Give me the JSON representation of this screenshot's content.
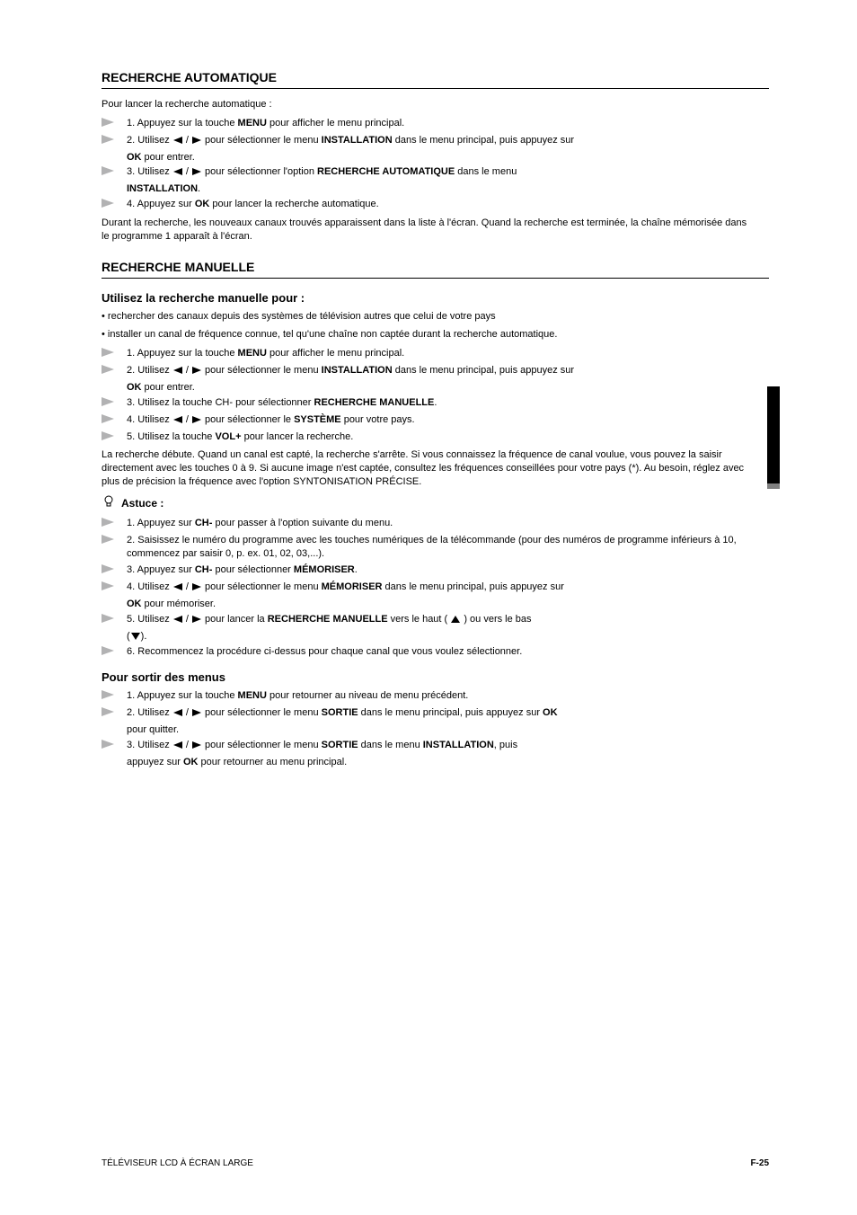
{
  "footer": {
    "left": "TÉLÉVISEUR LCD À ÉCRAN LARGE",
    "right": "F-25"
  },
  "sideTabColor": "#000000",
  "section1": {
    "title": "RECHERCHE AUTOMATIQUE",
    "intro": "",
    "steps": [
      {
        "num": "1.",
        "text_before": "Appuyez sur la touche ",
        "bold": "MENU",
        "text_after": " pour afficher le menu principal."
      },
      {
        "num": "2.",
        "text_before": "Utilisez ",
        "icons": true,
        "text_mid": " pour sélectionner le menu ",
        "bold": "INSTALLATION",
        "text_after": " dans le menu principal, puis appuyez sur"
      },
      {
        "continue": true,
        "bold": "OK",
        "text_after": " pour entrer."
      },
      {
        "num": "3.",
        "text_before": "Utilisez ",
        "icons": true,
        "text_mid": " pour sélectionner l'option ",
        "bold": "RECHERCHE AUTOMATIQUE",
        "text_after": " dans le menu"
      },
      {
        "continue": true,
        "bold": "INSTALLATION",
        "text_after": "."
      },
      {
        "num": "4.",
        "text_before": "Appuyez sur ",
        "bold": "OK",
        "text_after": " pour lancer la recherche automatique."
      }
    ],
    "outro": "Durant la recherche, les nouveaux canaux trouvés apparaissent dans la liste à l'écran. Quand la recherche est terminée, la chaîne mémorisée dans le programme 1 apparaît à l'écran."
  },
  "section2": {
    "title": "RECHERCHE MANUELLE",
    "subA": {
      "title": "Utilisez la recherche manuelle pour :",
      "lines": [
        "rechercher des canaux depuis des systèmes de télévision autres que celui de votre pays",
        "installer un canal de fréquence connue, tel qu'une chaîne non captée durant la recherche automatique."
      ]
    },
    "steps1": [
      {
        "num": "1.",
        "text_before": "Appuyez sur la touche ",
        "bold": "MENU",
        "text_after": " pour afficher le menu principal."
      },
      {
        "num": "2.",
        "text_before": "Utilisez ",
        "icons": true,
        "text_mid": " pour sélectionner le menu ",
        "bold": "INSTALLATION",
        "text_after": " dans le menu principal, puis appuyez sur"
      },
      {
        "continue": true,
        "bold": "OK",
        "text_after": " pour entrer."
      },
      {
        "num": "3.",
        "text_before": "Utilisez la touche CH- pour sélectionner ",
        "bold": "RECHERCHE MANUELLE",
        "text_after": "."
      },
      {
        "num": "4.",
        "text_before": "Utilisez ",
        "icons": true,
        "text_mid": " pour sélectionner le ",
        "bold": "SYSTÈME",
        "text_after": " pour votre pays."
      },
      {
        "num": "5.",
        "text_before": "Utilisez la touche ",
        "bold": "VOL+",
        "text_after": " pour lancer la recherche."
      }
    ],
    "standalone": "La recherche débute. Quand un canal est capté, la recherche s'arrête. Si vous connaissez la fréquence de canal voulue, vous pouvez la saisir directement avec les touches 0 à 9. Si aucune image n'est captée, consultez les fréquences conseillées pour votre pays (*). Au besoin, réglez avec plus de précision la fréquence avec l'option SYNTONISATION PRÉCISE.",
    "tip": "Astuce :",
    "steps2": [
      {
        "num": "1.",
        "text_before": "Appuyez sur ",
        "bold": "CH-",
        "text_after": " pour passer à l'option suivante du menu."
      },
      {
        "num": "2.",
        "text_before": "Saisissez le numéro du programme avec les touches numériques de la télécommande (pour des numéros de programme inférieurs à 10, commencez par saisir 0, p. ex. 01, 02, 03,...)."
      },
      {
        "num": "3.",
        "text_before": "Appuyez sur ",
        "bold": "CH-",
        "text_after": " pour sélectionner ",
        "bold2": "MÉMORISER",
        "text_after2": "."
      },
      {
        "num": "4.",
        "text_before": "Utilisez ",
        "icons": true,
        "text_mid": " pour sélectionner le menu ",
        "bold": "MÉMORISER",
        "text_after": " dans le menu principal, puis appuyez sur"
      },
      {
        "continue": true,
        "bold": "OK",
        "text_after": " pour mémoriser."
      },
      {
        "num": "5.",
        "text_before": "Utilisez ",
        "icons": true,
        "text_mid": " pour lancer la ",
        "bold": "RECHERCHE MANUELLE",
        "text_after": " vers le haut ("
      },
      {
        "trail2_icons": true,
        "trail2_text": ") ou vers le bas"
      },
      {
        "continue_icons_paren": true,
        "text_after": ")."
      },
      {
        "num": "6.",
        "text_before": "Recommencez la procédure ci-dessus pour chaque canal que vous voulez sélectionner."
      }
    ],
    "subC": {
      "title": "Pour sortir des menus",
      "steps": [
        {
          "num": "1.",
          "text_before": "Appuyez sur la touche ",
          "bold": "MENU",
          "text_after": " pour retourner au niveau de menu précédent."
        },
        {
          "num": "2.",
          "text_before": "Utilisez ",
          "icons": true,
          "text_mid": " pour sélectionner le menu ",
          "bold": "SORTIE",
          "text_after": " dans le menu principal, puis appuyez sur ",
          "bold2": "OK"
        },
        {
          "continue": true,
          "text_after": "pour quitter."
        },
        {
          "num": "3.",
          "text_before": "Utilisez ",
          "icons": true,
          "text_mid": " pour sélectionner le menu ",
          "bold": "SORTIE",
          "text_after": " dans le menu ",
          "bold2": "INSTALLATION",
          "text_after2": ", puis"
        },
        {
          "continue": true,
          "text_after": "appuyez sur ",
          "bold": "OK",
          "text_after2": " pour retourner au menu principal."
        }
      ]
    }
  }
}
